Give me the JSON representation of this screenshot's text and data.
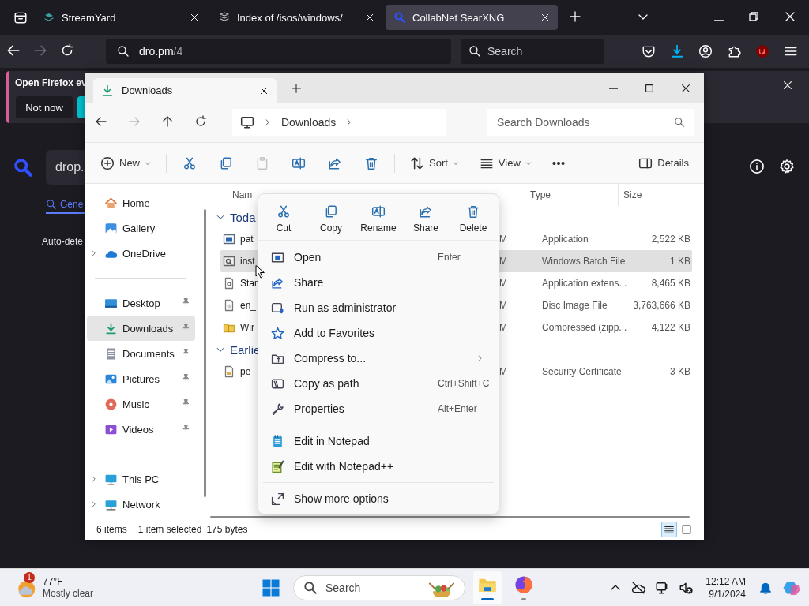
{
  "browser": {
    "tabs": [
      {
        "title": "StreamYard",
        "selected": false
      },
      {
        "title": "Index of /isos/windows/",
        "selected": false
      },
      {
        "title": "CollabNet SearXNG",
        "selected": true
      }
    ],
    "url": {
      "host": "dro.pm",
      "path": "/4"
    },
    "search": {
      "placeholder": "Search"
    }
  },
  "notification": {
    "text": "Open Firefox ev",
    "button": "Not now"
  },
  "page": {
    "query": "drop.",
    "tab": "Gene",
    "language": "Auto-dete"
  },
  "explorer": {
    "tab": "Downloads",
    "breadcrumb": "Downloads",
    "search": {
      "placeholder": "Search Downloads"
    },
    "toolbar": {
      "new": "New",
      "sort": "Sort",
      "view": "View",
      "details": "Details"
    },
    "sidebar": [
      [
        {
          "label": "Home",
          "expandable": false,
          "pinned": false,
          "selected": false
        },
        {
          "label": "Gallery",
          "expandable": false,
          "pinned": false,
          "selected": false
        },
        {
          "label": "OneDrive",
          "expandable": true,
          "pinned": false,
          "selected": false
        }
      ],
      [
        {
          "label": "Desktop",
          "expandable": false,
          "pinned": true,
          "selected": false
        },
        {
          "label": "Downloads",
          "expandable": false,
          "pinned": true,
          "selected": true
        },
        {
          "label": "Documents",
          "expandable": false,
          "pinned": true,
          "selected": false
        },
        {
          "label": "Pictures",
          "expandable": false,
          "pinned": true,
          "selected": false
        },
        {
          "label": "Music",
          "expandable": false,
          "pinned": true,
          "selected": false
        },
        {
          "label": "Videos",
          "expandable": false,
          "pinned": true,
          "selected": false
        }
      ],
      [
        {
          "label": "This PC",
          "expandable": true,
          "pinned": false,
          "selected": false
        },
        {
          "label": "Network",
          "expandable": true,
          "pinned": false,
          "selected": false
        }
      ]
    ],
    "columns": [
      "Nam",
      "Type",
      "Size"
    ],
    "groups": [
      {
        "label": "Toda",
        "expanded": true,
        "rows": [
          {
            "name": "pat",
            "date": "M",
            "type": "Application",
            "size": "2,522 KB",
            "selected": false
          },
          {
            "name": "inst",
            "date": "M",
            "type": "Windows Batch File",
            "size": "1 KB",
            "selected": true
          },
          {
            "name": "Star",
            "date": "M",
            "type": "Application extens...",
            "size": "8,465 KB",
            "selected": false
          },
          {
            "name": "en_",
            "date": "M",
            "type": "Disc Image File",
            "size": "3,763,666 KB",
            "selected": false
          },
          {
            "name": "Wir",
            "date": "M",
            "type": "Compressed (zipp...",
            "size": "4,122 KB",
            "selected": false
          }
        ]
      },
      {
        "label": "Earlie",
        "expanded": true,
        "rows": [
          {
            "name": "pe",
            "date": "M",
            "type": "Security Certificate",
            "size": "3 KB",
            "selected": false
          }
        ]
      }
    ],
    "status": {
      "count": "6 items",
      "selection": "1 item selected",
      "size": "175 bytes"
    },
    "view_buttons": [
      {
        "selected": true
      },
      {
        "selected": false
      }
    ]
  },
  "context_menu": {
    "actions": [
      "Cut",
      "Copy",
      "Rename",
      "Share",
      "Delete"
    ],
    "sections": [
      [
        {
          "label": "Open",
          "shortcut": "Enter"
        },
        {
          "label": "Share"
        },
        {
          "label": "Run as administrator"
        },
        {
          "label": "Add to Favorites"
        },
        {
          "label": "Compress to...",
          "submenu": true
        },
        {
          "label": "Copy as path",
          "shortcut": "Ctrl+Shift+C"
        },
        {
          "label": "Properties",
          "shortcut": "Alt+Enter"
        }
      ],
      [
        {
          "label": "Edit in Notepad"
        },
        {
          "label": "Edit with Notepad++"
        }
      ],
      [
        {
          "label": "Show more options"
        }
      ]
    ]
  },
  "taskbar": {
    "weather": {
      "badge": "1",
      "temperature": "77°F",
      "condition": "Mostly clear"
    },
    "search": {
      "placeholder": "Search"
    },
    "apps": [
      {
        "active": true
      },
      {
        "active": false
      }
    ],
    "clock": {
      "time": "12:12 AM",
      "date": "9/1/2024"
    }
  }
}
